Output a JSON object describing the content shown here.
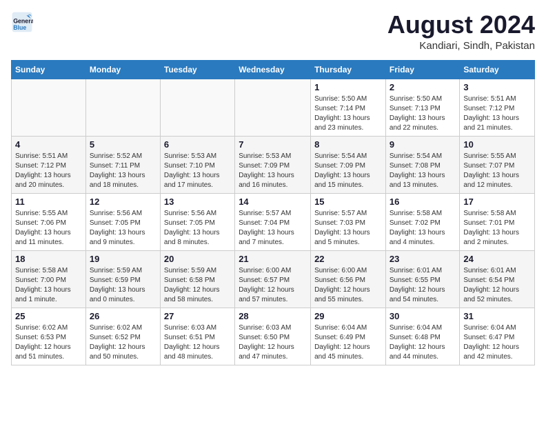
{
  "header": {
    "logo_line1": "General",
    "logo_line2": "Blue",
    "month": "August 2024",
    "location": "Kandiari, Sindh, Pakistan"
  },
  "weekdays": [
    "Sunday",
    "Monday",
    "Tuesday",
    "Wednesday",
    "Thursday",
    "Friday",
    "Saturday"
  ],
  "weeks": [
    [
      {
        "day": "",
        "info": ""
      },
      {
        "day": "",
        "info": ""
      },
      {
        "day": "",
        "info": ""
      },
      {
        "day": "",
        "info": ""
      },
      {
        "day": "1",
        "info": "Sunrise: 5:50 AM\nSunset: 7:14 PM\nDaylight: 13 hours\nand 23 minutes."
      },
      {
        "day": "2",
        "info": "Sunrise: 5:50 AM\nSunset: 7:13 PM\nDaylight: 13 hours\nand 22 minutes."
      },
      {
        "day": "3",
        "info": "Sunrise: 5:51 AM\nSunset: 7:12 PM\nDaylight: 13 hours\nand 21 minutes."
      }
    ],
    [
      {
        "day": "4",
        "info": "Sunrise: 5:51 AM\nSunset: 7:12 PM\nDaylight: 13 hours\nand 20 minutes."
      },
      {
        "day": "5",
        "info": "Sunrise: 5:52 AM\nSunset: 7:11 PM\nDaylight: 13 hours\nand 18 minutes."
      },
      {
        "day": "6",
        "info": "Sunrise: 5:53 AM\nSunset: 7:10 PM\nDaylight: 13 hours\nand 17 minutes."
      },
      {
        "day": "7",
        "info": "Sunrise: 5:53 AM\nSunset: 7:09 PM\nDaylight: 13 hours\nand 16 minutes."
      },
      {
        "day": "8",
        "info": "Sunrise: 5:54 AM\nSunset: 7:09 PM\nDaylight: 13 hours\nand 15 minutes."
      },
      {
        "day": "9",
        "info": "Sunrise: 5:54 AM\nSunset: 7:08 PM\nDaylight: 13 hours\nand 13 minutes."
      },
      {
        "day": "10",
        "info": "Sunrise: 5:55 AM\nSunset: 7:07 PM\nDaylight: 13 hours\nand 12 minutes."
      }
    ],
    [
      {
        "day": "11",
        "info": "Sunrise: 5:55 AM\nSunset: 7:06 PM\nDaylight: 13 hours\nand 11 minutes."
      },
      {
        "day": "12",
        "info": "Sunrise: 5:56 AM\nSunset: 7:05 PM\nDaylight: 13 hours\nand 9 minutes."
      },
      {
        "day": "13",
        "info": "Sunrise: 5:56 AM\nSunset: 7:05 PM\nDaylight: 13 hours\nand 8 minutes."
      },
      {
        "day": "14",
        "info": "Sunrise: 5:57 AM\nSunset: 7:04 PM\nDaylight: 13 hours\nand 7 minutes."
      },
      {
        "day": "15",
        "info": "Sunrise: 5:57 AM\nSunset: 7:03 PM\nDaylight: 13 hours\nand 5 minutes."
      },
      {
        "day": "16",
        "info": "Sunrise: 5:58 AM\nSunset: 7:02 PM\nDaylight: 13 hours\nand 4 minutes."
      },
      {
        "day": "17",
        "info": "Sunrise: 5:58 AM\nSunset: 7:01 PM\nDaylight: 13 hours\nand 2 minutes."
      }
    ],
    [
      {
        "day": "18",
        "info": "Sunrise: 5:58 AM\nSunset: 7:00 PM\nDaylight: 13 hours\nand 1 minute."
      },
      {
        "day": "19",
        "info": "Sunrise: 5:59 AM\nSunset: 6:59 PM\nDaylight: 13 hours\nand 0 minutes."
      },
      {
        "day": "20",
        "info": "Sunrise: 5:59 AM\nSunset: 6:58 PM\nDaylight: 12 hours\nand 58 minutes."
      },
      {
        "day": "21",
        "info": "Sunrise: 6:00 AM\nSunset: 6:57 PM\nDaylight: 12 hours\nand 57 minutes."
      },
      {
        "day": "22",
        "info": "Sunrise: 6:00 AM\nSunset: 6:56 PM\nDaylight: 12 hours\nand 55 minutes."
      },
      {
        "day": "23",
        "info": "Sunrise: 6:01 AM\nSunset: 6:55 PM\nDaylight: 12 hours\nand 54 minutes."
      },
      {
        "day": "24",
        "info": "Sunrise: 6:01 AM\nSunset: 6:54 PM\nDaylight: 12 hours\nand 52 minutes."
      }
    ],
    [
      {
        "day": "25",
        "info": "Sunrise: 6:02 AM\nSunset: 6:53 PM\nDaylight: 12 hours\nand 51 minutes."
      },
      {
        "day": "26",
        "info": "Sunrise: 6:02 AM\nSunset: 6:52 PM\nDaylight: 12 hours\nand 50 minutes."
      },
      {
        "day": "27",
        "info": "Sunrise: 6:03 AM\nSunset: 6:51 PM\nDaylight: 12 hours\nand 48 minutes."
      },
      {
        "day": "28",
        "info": "Sunrise: 6:03 AM\nSunset: 6:50 PM\nDaylight: 12 hours\nand 47 minutes."
      },
      {
        "day": "29",
        "info": "Sunrise: 6:04 AM\nSunset: 6:49 PM\nDaylight: 12 hours\nand 45 minutes."
      },
      {
        "day": "30",
        "info": "Sunrise: 6:04 AM\nSunset: 6:48 PM\nDaylight: 12 hours\nand 44 minutes."
      },
      {
        "day": "31",
        "info": "Sunrise: 6:04 AM\nSunset: 6:47 PM\nDaylight: 12 hours\nand 42 minutes."
      }
    ]
  ]
}
